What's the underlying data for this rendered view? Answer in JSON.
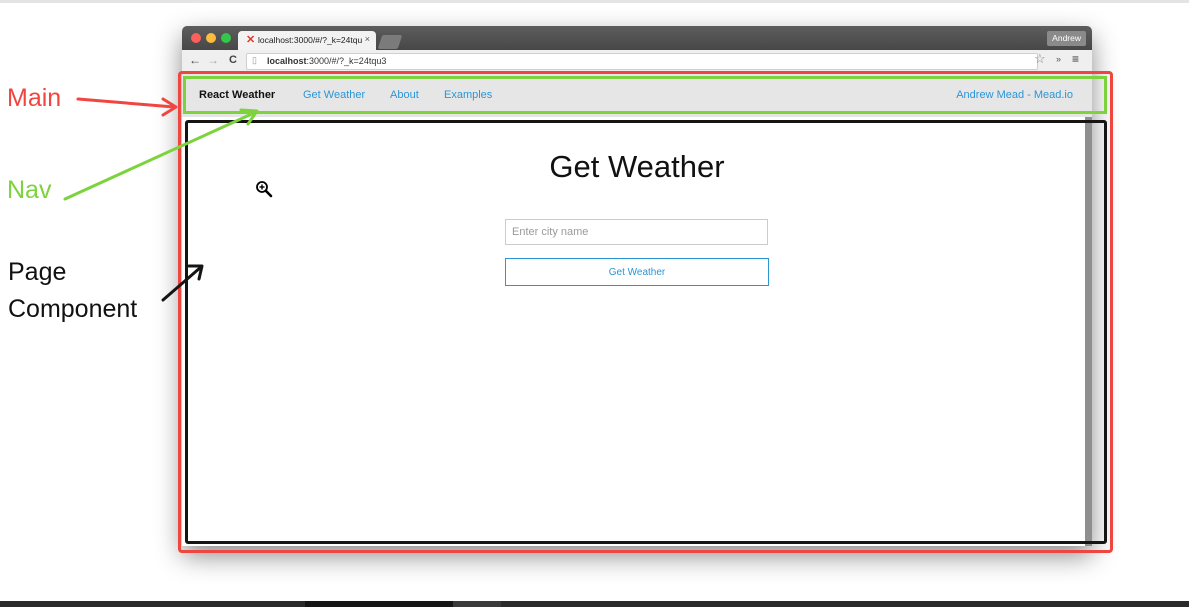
{
  "browser": {
    "tab_title": "localhost:3000/#/?_k=24tqu3",
    "tab_favicon": "react-favicon-icon",
    "tab_close": "×",
    "profile_name": "Andrew",
    "url_host": "localhost",
    "url_rest": ":3000/#/?_k=24tqu3",
    "back_glyph": "←",
    "forward_glyph": "→",
    "reload_glyph": "C",
    "star_glyph": "☆",
    "ext_glyph": "»",
    "menu_glyph": "≡"
  },
  "nav": {
    "brand": "React Weather",
    "items": [
      "Get Weather",
      "About",
      "Examples"
    ],
    "author": "Andrew Mead - Mead.io"
  },
  "page": {
    "title": "Get Weather",
    "input_placeholder": "Enter city name",
    "button_label": "Get Weather"
  },
  "annotations": {
    "main": "Main",
    "nav": "Nav",
    "page_line1": "Page",
    "page_line2": "Component"
  },
  "colors": {
    "main": "#f0463f",
    "nav": "#7dd33e",
    "page": "#151515",
    "link": "#2b95d6"
  }
}
